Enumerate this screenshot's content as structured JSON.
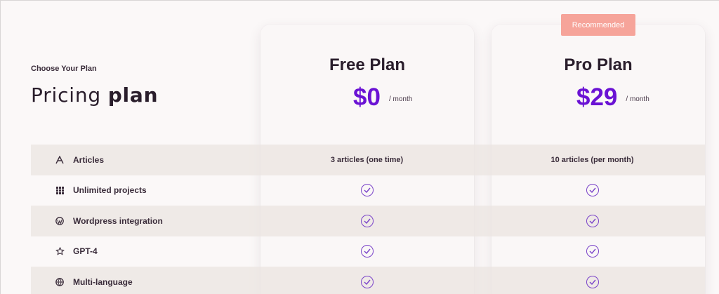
{
  "header": {
    "eyebrow": "Choose Your Plan",
    "title_regular": "Pricing",
    "title_bold": "plan"
  },
  "plans": [
    {
      "name": "Free Plan",
      "price": "$0",
      "period": "/ month"
    },
    {
      "name": "Pro Plan",
      "price": "$29",
      "period": "/ month",
      "badge": "Recommended"
    }
  ],
  "features": [
    {
      "label": "Articles",
      "icon": "font-icon",
      "free": "3 articles (one time)",
      "pro": "10 articles (per month)"
    },
    {
      "label": "Unlimited projects",
      "icon": "grid-icon",
      "free": "check",
      "pro": "check"
    },
    {
      "label": "Wordpress integration",
      "icon": "wordpress-icon",
      "free": "check",
      "pro": "check"
    },
    {
      "label": "GPT-4",
      "icon": "openai-icon",
      "free": "check",
      "pro": "check"
    },
    {
      "label": "Multi-language",
      "icon": "globe-icon",
      "free": "check",
      "pro": "check"
    }
  ],
  "colors": {
    "accent": "#6a12d4",
    "badge": "#f6a49a",
    "check": "#7a43c9",
    "row_shade": "#ece5e2"
  }
}
